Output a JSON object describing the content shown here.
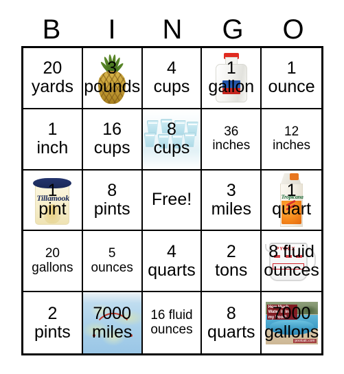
{
  "header": {
    "letters": [
      "B",
      "I",
      "N",
      "G",
      "O"
    ]
  },
  "grid": {
    "rows": [
      [
        {
          "num": "20",
          "unit": "yards",
          "art": "none",
          "size": "normal"
        },
        {
          "num": "3",
          "unit": "pounds",
          "art": "pineapple",
          "size": "normal"
        },
        {
          "num": "4",
          "unit": "cups",
          "art": "none",
          "size": "normal"
        },
        {
          "num": "1",
          "unit": "gallon",
          "art": "milk-jug",
          "size": "normal"
        },
        {
          "num": "1",
          "unit": "ounce",
          "art": "none",
          "size": "normal"
        }
      ],
      [
        {
          "num": "1",
          "unit": "inch",
          "art": "none",
          "size": "normal"
        },
        {
          "num": "16",
          "unit": "cups",
          "art": "none",
          "size": "normal"
        },
        {
          "num": "8",
          "unit": "cups",
          "art": "plastic-cups",
          "size": "normal"
        },
        {
          "num": "36",
          "unit": "inches",
          "art": "none",
          "size": "small"
        },
        {
          "num": "12",
          "unit": "inches",
          "art": "none",
          "size": "small"
        }
      ],
      [
        {
          "num": "1",
          "unit": "pint",
          "art": "ice-cream-tub",
          "size": "normal"
        },
        {
          "num": "8",
          "unit": "pints",
          "art": "none",
          "size": "normal"
        },
        {
          "num": "",
          "unit": "Free!",
          "art": "none",
          "size": "normal",
          "free": true
        },
        {
          "num": "3",
          "unit": "miles",
          "art": "none",
          "size": "normal"
        },
        {
          "num": "1",
          "unit": "quart",
          "art": "juice-carton",
          "size": "normal"
        }
      ],
      [
        {
          "num": "20",
          "unit": "gallons",
          "art": "none",
          "size": "small"
        },
        {
          "num": "5",
          "unit": "ounces",
          "art": "none",
          "size": "small"
        },
        {
          "num": "4",
          "unit": "quarts",
          "art": "none",
          "size": "normal"
        },
        {
          "num": "2",
          "unit": "tons",
          "art": "none",
          "size": "normal"
        },
        {
          "num": "8 fluid",
          "unit": "ounces",
          "art": "measuring-cup",
          "size": "normal"
        }
      ],
      [
        {
          "num": "2",
          "unit": "pints",
          "art": "none",
          "size": "normal"
        },
        {
          "num": "7000",
          "unit": "miles",
          "art": "world-map",
          "size": "normal"
        },
        {
          "num": "16 fluid",
          "unit": "ounces",
          "art": "none",
          "size": "small"
        },
        {
          "num": "8",
          "unit": "quarts",
          "art": "none",
          "size": "normal"
        },
        {
          "num": "7000",
          "unit": "gallons",
          "art": "swimming-pool",
          "size": "normal"
        }
      ]
    ]
  },
  "artwork": {
    "ice_cream_brand": "Tillamook",
    "juice_brand": "Tropicana",
    "measuring_cup_brand": "PYREX",
    "pool_banner_text": "How Much Water Is In my Pool?",
    "pool_credit": "poolcalc.com"
  },
  "colors": {
    "border": "#000000",
    "background": "#ffffff",
    "text": "#000000"
  }
}
